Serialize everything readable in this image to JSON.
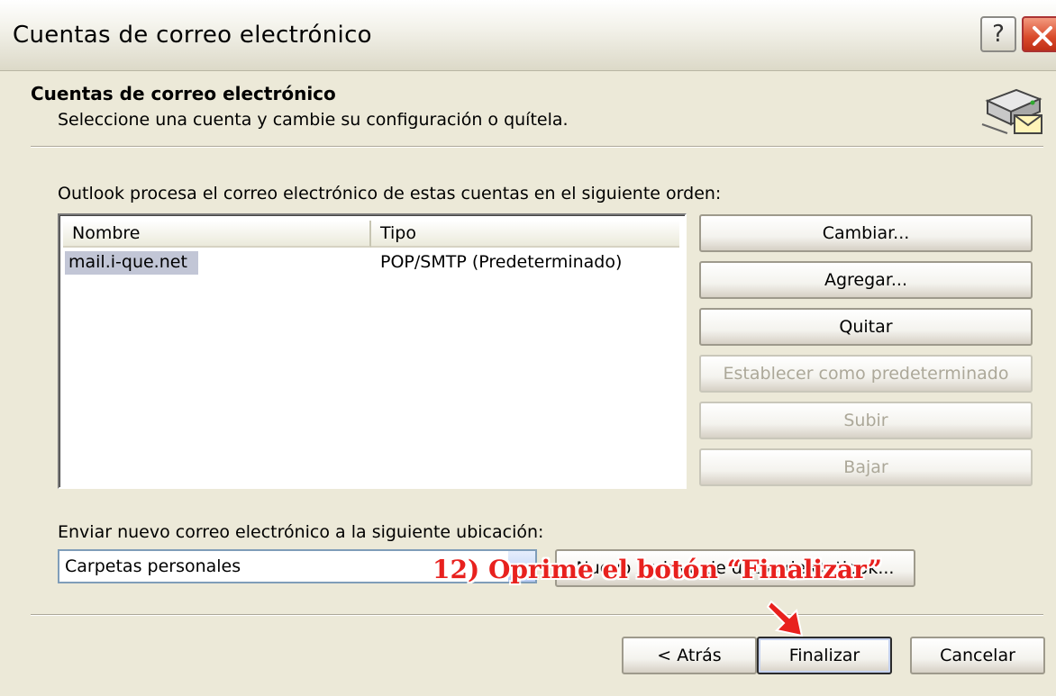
{
  "window": {
    "title": "Cuentas de correo electrónico",
    "help_label": "?"
  },
  "header": {
    "title": "Cuentas de correo electrónico",
    "subtitle": "Seleccione una cuenta y cambie su configuración o quítela."
  },
  "accounts": {
    "description": "Outlook procesa el correo electrónico de estas cuentas en el siguiente orden:",
    "columns": [
      "Nombre",
      "Tipo"
    ],
    "rows": [
      {
        "name": "mail.i-que.net",
        "type": "POP/SMTP (Predeterminado)",
        "selected": true
      }
    ]
  },
  "side_buttons": {
    "change": "Cambiar...",
    "add": "Agregar...",
    "remove": "Quitar",
    "set_default": "Establecer como predeterminado",
    "up": "Subir",
    "down": "Bajar"
  },
  "delivery": {
    "label": "Enviar nuevo correo electrónico a la siguiente ubicación:",
    "selected": "Carpetas personales",
    "new_file_button": "Nuevo archivo de datos de Outlook..."
  },
  "annotation": {
    "text": "12) Oprime el botón “Finalizar”",
    "color": "#e8211e"
  },
  "footer": {
    "back": "< Atrás",
    "finish": "Finalizar",
    "cancel": "Cancelar"
  },
  "icons": [
    "help-icon",
    "close-icon",
    "mail-server-icon",
    "dropdown-arrow-icon",
    "pointer-arrow-icon"
  ]
}
